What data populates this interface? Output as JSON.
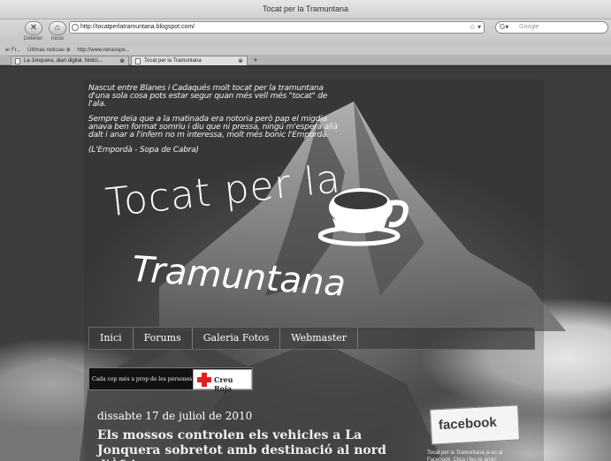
{
  "window": {
    "title": "Tocat per la Tramuntana"
  },
  "toolbar": {
    "back_icon": "close-x-icon",
    "home_icon": "home-icon",
    "stop_label": "Detener",
    "home_label": "Inicio",
    "url": "http://tocatperlatramuntana.blogspot.com/",
    "search_placeholder": "Google"
  },
  "bookmarks": [
    "er Fr...",
    "Últimas noticias ⊕",
    "http://www.nerasope..."
  ],
  "tabs": [
    {
      "label": "La Jonquera, diari digital. Notici...",
      "active": false
    },
    {
      "label": "Tocat per la Tramuntana",
      "active": true
    }
  ],
  "blog": {
    "quote": [
      "Nascut entre Blanes i Cadaqués molt tocat per la tramuntana d'una sola cosa pots estar segur quan més vell més \"tocat\" de l'ala.",
      "Sempre deia que a la matinada era notoria però pap el migdia anava ben format somriu i diu que ni pressa, ningú m'espera allà dalt i anar a l'infern no m interessa, molt més bonic l'Empordà.",
      "(L'Empordà - Sopa de Cabra)"
    ],
    "title_line1": "Tocat per la",
    "title_line2": "Tramuntana",
    "nav": [
      "Inici",
      "Forums",
      "Galeria Fotos",
      "Webmaster"
    ],
    "badge_text": "Cada cop més a prop de les persones",
    "badge_org": "Creu Roja",
    "date": "dissabte 17 de juliol de 2010",
    "post_title": "Els mossos controlen els vehicles a La Jonquera sobretot amb destinació al nord d'Àfrica",
    "facebook_label": "facebook",
    "facebook_text": "Tocat per la Tramuntana ja es al Facebook. Clica i fes-te amic!"
  }
}
